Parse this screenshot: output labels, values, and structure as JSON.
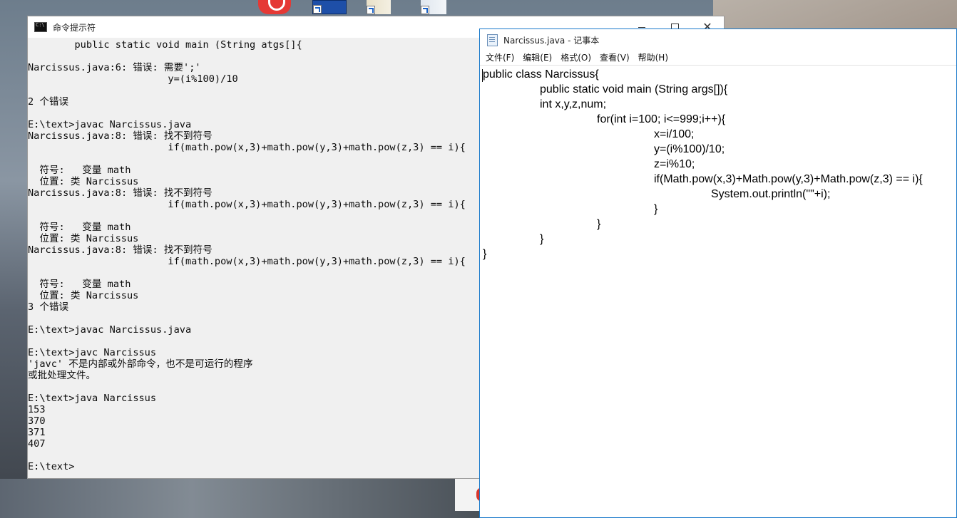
{
  "cmd": {
    "title": "命令提示符",
    "lines": [
      "        public static void main (String atgs[]{",
      "",
      "Narcissus.java:6: 错误: 需要';'",
      "                        y=(i%100)/10",
      "",
      "2 个错误",
      "",
      "E:\\text>javac Narcissus.java",
      "Narcissus.java:8: 错误: 找不到符号",
      "                        if(math.pow(x,3)+math.pow(y,3)+math.pow(z,3) == i){",
      "",
      "  符号:   变量 math",
      "  位置: 类 Narcissus",
      "Narcissus.java:8: 错误: 找不到符号",
      "                        if(math.pow(x,3)+math.pow(y,3)+math.pow(z,3) == i){",
      "",
      "  符号:   变量 math",
      "  位置: 类 Narcissus",
      "Narcissus.java:8: 错误: 找不到符号",
      "                        if(math.pow(x,3)+math.pow(y,3)+math.pow(z,3) == i){",
      "",
      "  符号:   变量 math",
      "  位置: 类 Narcissus",
      "3 个错误",
      "",
      "E:\\text>javac Narcissus.java",
      "",
      "E:\\text>javc Narcissus",
      "'javc' 不是内部或外部命令，也不是可运行的程序",
      "或批处理文件。",
      "",
      "E:\\text>java Narcissus",
      "153",
      "370",
      "371",
      "407",
      "",
      "E:\\text>"
    ]
  },
  "notepad": {
    "title": "Narcissus.java - 记事本",
    "menu": [
      "文件(F)",
      "编辑(E)",
      "格式(O)",
      "查看(V)",
      "帮助(H)"
    ],
    "code_lines": [
      {
        "indent": 0,
        "text": "public class Narcissus{"
      },
      {
        "indent": 1,
        "text": "public static void main (String args[]){"
      },
      {
        "indent": 1,
        "text": "int x,y,z,num;"
      },
      {
        "indent": 2,
        "text": "for(int i=100; i<=999;i++){"
      },
      {
        "indent": 3,
        "text": "x=i/100;"
      },
      {
        "indent": 3,
        "text": "y=(i%100)/10;"
      },
      {
        "indent": 3,
        "text": "z=i%10;"
      },
      {
        "indent": 3,
        "text": "if(Math.pow(x,3)+Math.pow(y,3)+Math.pow(z,3) == i){"
      },
      {
        "indent": 4,
        "text": "System.out.println(\"\"+i);"
      },
      {
        "indent": 3,
        "text": "}"
      },
      {
        "indent": 2,
        "text": "}"
      },
      {
        "indent": 1,
        "text": "}"
      },
      {
        "indent": 0,
        "text": "}"
      }
    ]
  }
}
